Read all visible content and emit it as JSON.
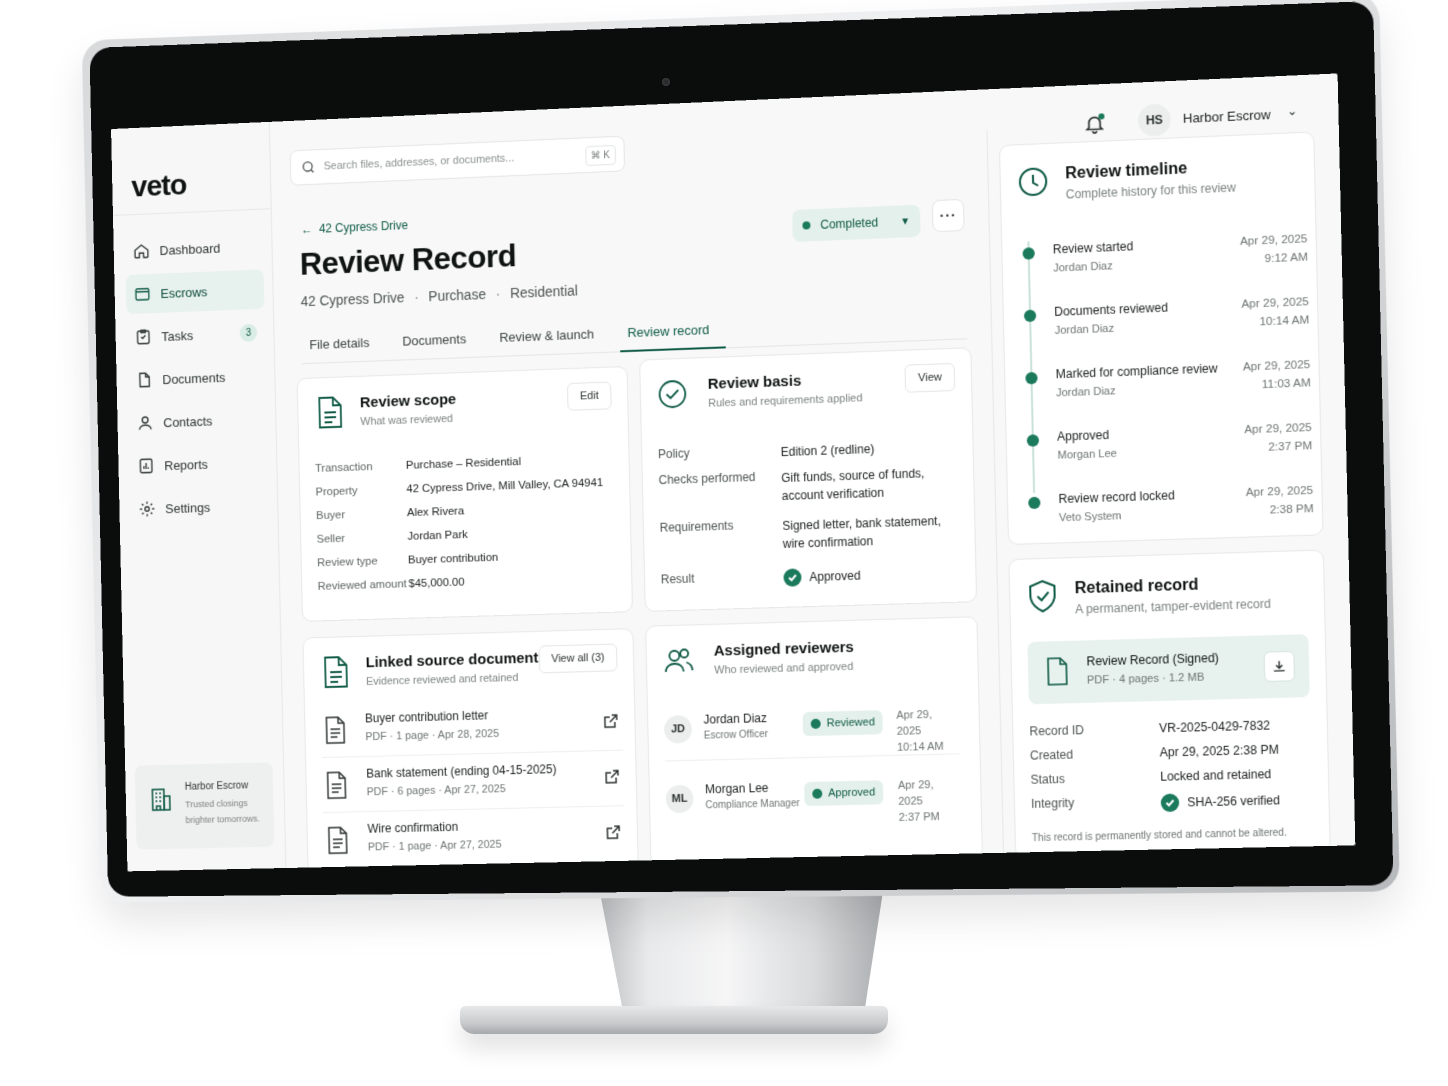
{
  "app": {
    "logo": "veto"
  },
  "sidebar": {
    "items": [
      {
        "label": "Dashboard",
        "icon": "home-icon"
      },
      {
        "label": "Escrows",
        "icon": "folder-icon",
        "active": true
      },
      {
        "label": "Tasks",
        "icon": "checklist-icon",
        "badge": "3"
      },
      {
        "label": "Documents",
        "icon": "file-icon"
      },
      {
        "label": "Contacts",
        "icon": "user-icon"
      },
      {
        "label": "Reports",
        "icon": "report-icon"
      },
      {
        "label": "Settings",
        "icon": "gear-icon"
      }
    ],
    "org_card": {
      "name": "Harbor Escrow",
      "tagline": "Trusted closings\nbrighter tomorrows."
    }
  },
  "topbar": {
    "search_placeholder": "Search files, addresses, or documents...",
    "shortcut": "⌘ K",
    "user_initials": "HS",
    "org_name": "Harbor Escrow"
  },
  "header": {
    "back_label": "42 Cypress Drive",
    "title": "Review Record",
    "subtitle_address": "42 Cypress Drive",
    "subtitle_type": "Purchase",
    "subtitle_category": "Residential",
    "status": "Completed",
    "more": "···"
  },
  "tabs": [
    {
      "label": "File details"
    },
    {
      "label": "Documents"
    },
    {
      "label": "Review & launch"
    },
    {
      "label": "Review record",
      "active": true
    }
  ],
  "review_scope": {
    "title": "Review scope",
    "subtitle": "What was reviewed",
    "button": "Edit",
    "rows": [
      {
        "k": "Transaction",
        "v": "Purchase – Residential"
      },
      {
        "k": "Property",
        "v": "42 Cypress Drive, Mill Valley, CA 94941"
      },
      {
        "k": "Buyer",
        "v": "Alex Rivera"
      },
      {
        "k": "Seller",
        "v": "Jordan Park"
      },
      {
        "k": "Review type",
        "v": "Buyer contribution"
      },
      {
        "k": "Reviewed amount",
        "v": "$45,000.00"
      }
    ]
  },
  "review_basis": {
    "title": "Review basis",
    "subtitle": "Rules and requirements applied",
    "button": "View",
    "rows": [
      {
        "k": "Policy",
        "v": "Edition 2 (redline)"
      },
      {
        "k": "Checks performed",
        "v": "Gift funds, source of funds, account verification"
      },
      {
        "k": "Requirements",
        "v": "Signed letter, bank statement, wire confirmation"
      }
    ],
    "result_label": "Result",
    "result_value": "Approved"
  },
  "linked_docs": {
    "title": "Linked source documents",
    "subtitle": "Evidence reviewed and retained",
    "button": "View all (3)",
    "items": [
      {
        "name": "Buyer contribution letter",
        "meta": "PDF · 1 page · Apr 28, 2025"
      },
      {
        "name": "Bank statement (ending 04-15-2025)",
        "meta": "PDF · 6 pages · Apr 27, 2025"
      },
      {
        "name": "Wire confirmation",
        "meta": "PDF · 1 page · Apr 27, 2025"
      }
    ]
  },
  "reviewers": {
    "title": "Assigned reviewers",
    "subtitle": "Who reviewed and approved",
    "items": [
      {
        "initials": "JD",
        "name": "Jordan Diaz",
        "role": "Escrow Officer",
        "status": "Reviewed",
        "date": "Apr 29, 2025",
        "time": "10:14 AM"
      },
      {
        "initials": "ML",
        "name": "Morgan Lee",
        "role": "Compliance Manager",
        "status": "Approved",
        "date": "Apr 29, 2025",
        "time": "2:37 PM"
      }
    ]
  },
  "timeline": {
    "title": "Review timeline",
    "subtitle": "Complete history for this review",
    "items": [
      {
        "title": "Review started",
        "by": "Jordan Diaz",
        "date": "Apr 29, 2025",
        "time": "9:12 AM"
      },
      {
        "title": "Documents reviewed",
        "by": "Jordan Diaz",
        "date": "Apr 29, 2025",
        "time": "10:14 AM"
      },
      {
        "title": "Marked for compliance review",
        "by": "Jordan Diaz",
        "date": "Apr 29, 2025",
        "time": "11:03 AM"
      },
      {
        "title": "Approved",
        "by": "Morgan Lee",
        "date": "Apr 29, 2025",
        "time": "2:37 PM"
      },
      {
        "title": "Review record locked",
        "by": "Veto System",
        "date": "Apr 29, 2025",
        "time": "2:38 PM"
      }
    ]
  },
  "retained": {
    "title": "Retained record",
    "subtitle": "A permanent, tamper-evident record",
    "file_name": "Review Record (Signed)",
    "file_meta": "PDF · 4 pages · 1.2 MB",
    "rows": [
      {
        "k": "Record ID",
        "v": "VR-2025-0429-7832"
      },
      {
        "k": "Created",
        "v": "Apr 29, 2025 2:38 PM"
      },
      {
        "k": "Status",
        "v": "Locked and retained"
      },
      {
        "k": "Integrity",
        "v": "SHA-256 verified"
      }
    ],
    "footnote": "This record is permanently stored and cannot be altered."
  },
  "colors": {
    "accent": "#0e5a45",
    "accent_green": "#1b7a5c",
    "accent_bg": "#e4f0eb"
  }
}
